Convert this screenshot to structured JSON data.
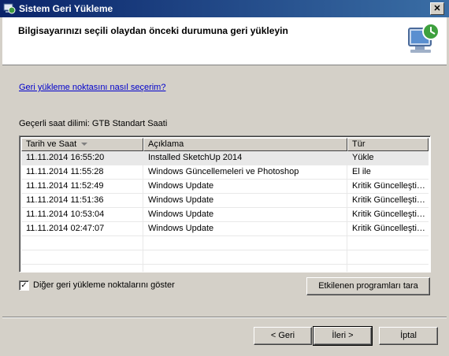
{
  "window": {
    "title": "Sistem Geri Yükleme",
    "close": "✕"
  },
  "header": {
    "heading": "Bilgisayarınızı seçili olaydan önceki durumuna geri yükleyin"
  },
  "help_link": "Geri yükleme noktasını nasıl seçerim?",
  "timezone": "Geçerli saat dilimi: GTB Standart Saati",
  "table": {
    "columns": [
      "Tarih ve Saat",
      "Açıklama",
      "Tür"
    ],
    "rows": [
      [
        "11.11.2014 16:55:20",
        "Installed SketchUp 2014",
        "Yükle"
      ],
      [
        "11.11.2014 11:55:28",
        "Windows Güncellemeleri ve Photoshop",
        "El ile"
      ],
      [
        "11.11.2014 11:52:49",
        "Windows Update",
        "Kritik Güncelleşti…"
      ],
      [
        "11.11.2014 11:51:36",
        "Windows Update",
        "Kritik Güncelleşti…"
      ],
      [
        "11.11.2014 10:53:04",
        "Windows Update",
        "Kritik Güncelleşti…"
      ],
      [
        "11.11.2014 02:47:07",
        "Windows Update",
        "Kritik Güncelleşti…"
      ]
    ]
  },
  "show_more": {
    "label": "Diğer geri yükleme noktalarını göster",
    "checked": true,
    "mark": "✓"
  },
  "buttons": {
    "scan": "Etkilenen programları tara",
    "back": "< Geri",
    "next": "İleri >",
    "cancel": "İptal"
  }
}
